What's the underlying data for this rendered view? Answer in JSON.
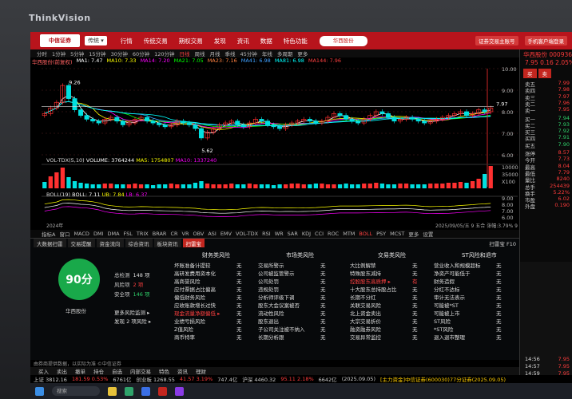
{
  "monitor": {
    "brand": "ThinkVision"
  },
  "menubar": {
    "logo": "中信证券",
    "dropdown": "传统 ▾",
    "items": [
      "行情",
      "传统交易",
      "期权交易",
      "发现",
      "资讯",
      "数据",
      "特色功能"
    ],
    "search": "华西股份",
    "right_items": [
      "证券交易主账号",
      "手机客户端登录"
    ]
  },
  "periods": [
    "分时",
    "1分钟",
    "5分钟",
    "15分钟",
    "30分钟",
    "60分钟",
    "120分钟",
    "日线",
    "周线",
    "月线",
    "季线",
    "45分钟",
    "年线",
    "多周期",
    "更多"
  ],
  "ma_legend": {
    "stock": "华西股份(前复权)",
    "ma1": "MA1: 7.47",
    "ma10": "MA10: 7.33",
    "ma14": "MA14: 7.20",
    "ma21": "MA21: 7.05",
    "ma23": "MA23: 7.16",
    "ma41": "MA41: 6.98",
    "ma81": "MA81: 6.98",
    "ma144": "MA144: 7.96"
  },
  "colors": {
    "ma1": "#ffffff",
    "ma10": "#ffff00",
    "ma14": "#ff00ff",
    "ma21": "#00ff00",
    "ma23": "#ff8040",
    "ma41": "#40a0ff",
    "ma81": "#00ffff",
    "ma144": "#ff4040"
  },
  "chart_labels": {
    "high": "9.26",
    "low": "5.62",
    "last_right": "7.97"
  },
  "chart_data": {
    "type": "candlestick",
    "title": "华西股份",
    "price_axis": [
      "10.00",
      "9.00",
      "8.00",
      "7.00",
      "6.00"
    ],
    "volume_axis": [
      "10000",
      "35000",
      "X100"
    ],
    "boll_axis": [
      "9.00",
      "8.00",
      "7.00",
      "6.00"
    ],
    "x_labels": [
      "2024年",
      "2025/09/05/五",
      "9"
    ],
    "highlights": {
      "high": 9.26,
      "low": 5.62,
      "current": 7.97
    },
    "close_series": [
      7.6,
      7.9,
      8.2,
      9.1,
      8.4,
      7.8,
      7.5,
      7.3,
      7.2,
      7.1,
      7.3,
      7.4,
      7.2,
      7.0,
      7.1,
      7.3,
      7.4,
      7.2,
      7.1,
      7.0,
      6.9,
      7.0,
      7.2,
      7.1,
      7.0,
      6.8,
      6.3,
      6.6,
      6.8,
      7.0,
      7.1,
      7.2,
      7.0,
      6.9,
      7.1,
      7.3,
      7.2,
      7.0,
      6.9,
      6.8,
      7.0,
      7.1,
      7.2,
      7.3,
      7.2,
      7.1,
      7.2,
      7.4,
      7.6,
      7.5,
      7.3,
      7.2,
      7.1,
      7.3,
      7.5,
      7.7,
      7.6,
      7.4,
      7.2,
      7.3,
      7.4,
      7.3,
      7.2,
      7.1,
      7.2,
      7.3,
      7.4,
      7.5,
      7.6,
      7.7,
      7.5,
      7.6,
      7.8,
      7.7,
      7.9
    ],
    "volume_series": [
      8,
      15,
      20,
      26,
      14,
      9,
      7,
      6,
      5,
      5,
      6,
      6,
      5,
      5,
      5,
      6,
      5,
      5,
      4,
      5,
      5,
      6,
      5,
      5,
      5,
      7,
      9,
      6,
      5,
      5,
      5,
      6,
      5,
      5,
      6,
      5,
      5,
      5,
      4,
      5,
      5,
      6,
      6,
      5,
      5,
      6,
      6,
      5,
      5,
      5,
      6,
      5,
      5,
      6,
      6,
      7,
      6,
      5,
      5,
      6,
      6,
      5,
      5,
      5,
      6,
      6,
      6,
      7,
      7,
      8,
      7,
      9,
      12,
      18,
      28
    ]
  },
  "vol_legend": {
    "name": "VOL-TDX(5,10)",
    "volume": "VOLUME: 3764244",
    "ma5": "MA5: 1754807",
    "ma10": "MA10: 1337240"
  },
  "boll_legend": {
    "name": "BOLL(19)",
    "boll": "BOLL: 7.11",
    "ub": "UB: 7.84",
    "lb": "LB: 6.37"
  },
  "axis_dates": {
    "left": "2024年",
    "right": "2025/09/05/五  9  五合 张幅:3.79%  9"
  },
  "indicators": [
    "指标A",
    "窗口",
    "MACD",
    "DMI",
    "DMA",
    "FSL",
    "TRIX",
    "BRAR",
    "CR",
    "VR",
    "OBV",
    "ASI",
    "EMV",
    "VOL-TDX",
    "RSI",
    "WR",
    "SAR",
    "KDJ",
    "CCI",
    "ROC",
    "MTM",
    "BOLL",
    "PSY",
    "MCST",
    "更多",
    "设置"
  ],
  "risk": {
    "tabs": [
      "大数据扫雷",
      "交易提醒",
      "资金流向",
      "综合资讯",
      "板块资讯",
      "扫雷宝"
    ],
    "top_right": "扫雷宝 F10",
    "score": "90分",
    "company": "华西股份",
    "stats": [
      {
        "label": "总检测",
        "val": "148 项"
      },
      {
        "label": "风险项",
        "val": "2 项"
      },
      {
        "label": "安全项",
        "val": "146 项"
      }
    ],
    "more": "更多风险监测 ▸",
    "found": "发现 2 项风险 ▸",
    "groups": [
      {
        "head": "财务类风险",
        "rows": [
          "坏账准备计提较",
          "高研发费用资本化",
          "高商誉风险",
          "应付票据占比偏高",
          "偏低财务风险",
          "应收账款增长过快",
          "现金流量净额偏低 ▸",
          "业绩亏损风险",
          "Z值风险",
          "商币特率"
        ],
        "vals": [
          "无",
          "无",
          "无",
          "无",
          "无",
          "无",
          "无",
          "无",
          "无",
          "无"
        ]
      },
      {
        "head": "市场类风险",
        "rows": [
          "交易所警示",
          "公司被监管警示",
          "公司处罚",
          "违规处罚",
          "分析师评级下调",
          "股东大会议案被否",
          "流动性风险",
          "股东退出",
          "子公司关注被不纳入",
          "长期分析跟"
        ],
        "vals": [
          "无",
          "无",
          "无",
          "无",
          "无",
          "无",
          "无",
          "无",
          "无",
          "无"
        ]
      },
      {
        "head": "交易类风险",
        "rows": [
          "大比例解禁",
          "特殊股东减持",
          "控股股东高质押 ▸",
          "十大股东总持股占比",
          "长期不分红",
          "关联交易风险",
          "北上资金卖出",
          "大宗交易折价",
          "融资融券风险",
          "交易异常监控"
        ],
        "vals": [
          "无",
          "无",
          "有",
          "无",
          "无",
          "无",
          "无",
          "无",
          "无",
          "无"
        ]
      },
      {
        "head": "ST风险和退市",
        "rows": [
          "营业收入和规模超标",
          "净资产可能低于",
          "财务造假",
          "分红不达标",
          "审计无法表示",
          "可能被*ST",
          "可能被上市",
          "ST风险",
          "*ST风险",
          "退入退市整理"
        ],
        "vals": [
          "无",
          "无",
          "无",
          "无",
          "无",
          "无",
          "无",
          "无",
          "无",
          "无"
        ]
      }
    ]
  },
  "sidebar": {
    "code": "华西股份 000936",
    "price": "7.95  0.16  2.05%",
    "buttons": [
      "买",
      "卖"
    ],
    "sell_rows": [
      {
        "l": "卖五",
        "v": "7.99"
      },
      {
        "l": "卖四",
        "v": "7.98"
      },
      {
        "l": "卖三",
        "v": "7.97"
      },
      {
        "l": "卖二",
        "v": "7.96"
      },
      {
        "l": "卖一",
        "v": "7.95"
      }
    ],
    "buy_rows": [
      {
        "l": "买一",
        "v": "7.94"
      },
      {
        "l": "买二",
        "v": "7.93"
      },
      {
        "l": "买三",
        "v": "7.92"
      },
      {
        "l": "买四",
        "v": "7.91"
      },
      {
        "l": "买五",
        "v": "7.90"
      }
    ],
    "info_rows": [
      {
        "l": "涨停",
        "v": "8.57"
      },
      {
        "l": "今开",
        "v": "7.73"
      },
      {
        "l": "最高",
        "v": "8.04"
      },
      {
        "l": "最低",
        "v": "7.79"
      },
      {
        "l": "量比",
        "v": "8240"
      },
      {
        "l": "总手",
        "v": "254439"
      },
      {
        "l": "换手",
        "v": "5.22%"
      },
      {
        "l": "市盈",
        "v": "6.02"
      },
      {
        "l": "外盘",
        "v": "0.190"
      }
    ]
  },
  "ticks": [
    {
      "t": "14:56",
      "v": "7.95"
    },
    {
      "t": "14:57",
      "v": "7.95"
    },
    {
      "t": "14:59",
      "v": "7.95"
    },
    {
      "t": "15:00",
      "v": "7.95"
    }
  ],
  "footer_msg": "由券商提供数据，以实际为准 ©中信证券",
  "toolbar": [
    "买入",
    "卖出",
    "撤单",
    "持仓",
    "自选",
    "内部交易",
    "特色",
    "资讯",
    "理财"
  ],
  "statusbar": {
    "sh": "上证 3812.16",
    "sh_chg": "181.59 0.53%",
    "sz": "6761亿",
    "cyb": "创业板 1268.55",
    "cyb_chg": "41.57 3.19%",
    "amt": "747.4亿",
    "hs": "沪深 4460.32",
    "hs_chg": "95.11 2.18%",
    "amt2": "6642亿",
    "date": "(2025.09.05)",
    "news": "[主力资金]中信证券(600030)77分证券(2025.09.05)"
  },
  "taskbar": {
    "search": "搜索"
  }
}
